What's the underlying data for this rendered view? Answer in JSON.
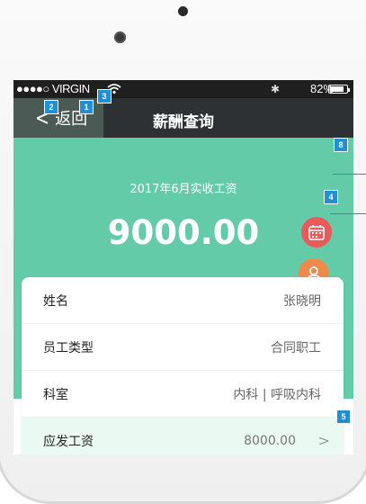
{
  "status_bar": {
    "carrier": "●●●●○ VIRGIN",
    "battery": "82%",
    "battery_level": 0.82
  },
  "nav": {
    "back_label": "返回",
    "title": "薪酬查询"
  },
  "hero": {
    "subtitle": "2017年6月实收工资",
    "amount": "9000.00"
  },
  "rows": [
    {
      "label": "姓名",
      "value": "张晓明"
    },
    {
      "label": "员工类型",
      "value": "合同职工"
    },
    {
      "label": "科室",
      "value": "内科 | 呼吸内科"
    },
    {
      "label": "应发工资",
      "value": "8000.00"
    }
  ],
  "markers": [
    "1",
    "2",
    "3",
    "8",
    "4",
    "5"
  ],
  "icons": [
    "wifi-icon",
    "bluetooth-icon",
    "battery-icon",
    "back-chevron-icon",
    "calendar-icon",
    "doctor-icon",
    "chevron-right-icon"
  ],
  "colors": {
    "accent": "#64cba8",
    "nav_bg": "#2e3133",
    "fab_calendar": "#ea5a5a",
    "fab_doctor": "#f08a4c",
    "marker": "#1f8fd6"
  }
}
